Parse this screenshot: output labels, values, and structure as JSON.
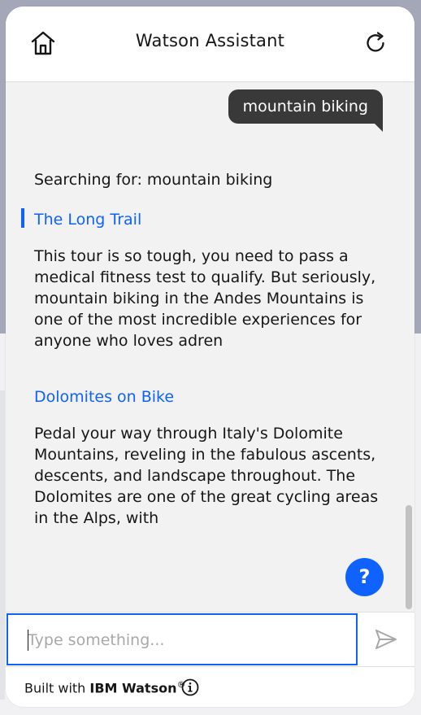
{
  "header": {
    "title": "Watson Assistant",
    "home_icon": "home-icon",
    "restart_icon": "restart-icon"
  },
  "conversation": {
    "user_message": "mountain biking",
    "searching_text": "Searching for: mountain biking",
    "results": [
      {
        "title": "The Long Trail",
        "description": "This tour is so tough, you need to pass a medical fitness test to qualify. But seriously, mountain biking in the Andes Mountains is one of the most incredible experiences for anyone who loves adren"
      },
      {
        "title": "Dolomites on Bike",
        "description": "Pedal your way through Italy's Dolomite Mountains, reveling in the fabulous ascents, descents, and landscape throughout.  The Dolomites are one of the great cycling areas in the Alps, with"
      }
    ],
    "help_label": "?"
  },
  "input": {
    "value": "",
    "placeholder": "Type something...",
    "send_icon": "send-icon"
  },
  "footer": {
    "prefix": "Built with ",
    "brand": "IBM Watson",
    "registered": "®",
    "info_icon": "info-icon"
  },
  "colors": {
    "accent": "#0f62fe",
    "user_bubble": "#393939",
    "chat_background": "#f2f2f2"
  }
}
